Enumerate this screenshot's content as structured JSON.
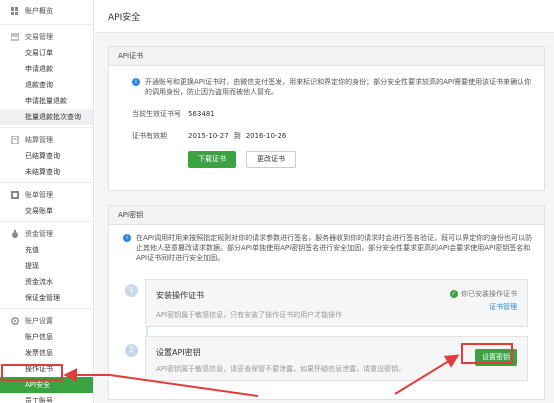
{
  "sidebar": {
    "account_overview": "账户概览",
    "trade_mgmt": {
      "title": "交易管理",
      "items": [
        "交易订单",
        "申请退款",
        "退款查询",
        "申请批量退款",
        "批量退款批次查询"
      ]
    },
    "settle_mgmt": {
      "title": "结算管理",
      "items": [
        "已结算查询",
        "未结算查询"
      ]
    },
    "bill_mgmt": {
      "title": "账单管理",
      "items": [
        "交易账单"
      ]
    },
    "fund_mgmt": {
      "title": "资金管理",
      "items": [
        "充值",
        "提现",
        "资金流水",
        "保证金管理"
      ]
    },
    "account_settings": {
      "title": "账户设置",
      "items": [
        "账户信息",
        "发票信息",
        "操作证书",
        "API安全",
        "员工账号"
      ]
    }
  },
  "main": {
    "title": "API安全",
    "cert_panel": {
      "title": "API证书",
      "note": "开通账号和更换API证书时，由微信支付签发，用来标识和界定你的身份；部分安全性要求较高的API需要使用该证书来确认你的调用身份，防止因为盗用而被他人冒充。",
      "cert_no_label": "当前生效证书号",
      "cert_no": "563481",
      "valid_label": "证书有效期",
      "valid_from": "2015-10-27",
      "valid_to_sep": "到",
      "valid_to": "2016-10-26",
      "download_btn": "下载证书",
      "change_btn": "更改证书"
    },
    "key_panel": {
      "title": "API密钥",
      "note": "在API调用时用来按照指定规则对你的请求参数进行签名，服务器收到你的请求时会进行签名验证，既可以界定你的身份也可以防止其他人恶意篡改请求数据。部分API单独使用API密钥签名进行安全加固，部分安全性要求更高的API会要求使用API密钥签名和API证书同时进行安全加固。",
      "step1": {
        "num": "1",
        "title": "安装操作证书",
        "desc": "API密钥属于敏感信息，只有安装了操作证书的用户才能操作",
        "status": "你已安装操作证书",
        "link": "证书管理"
      },
      "step2": {
        "num": "2",
        "title": "设置API密钥",
        "desc": "API密钥属于敏感信息，请妥善保管不要泄露，如果怀疑信息泄露，请重设密钥。",
        "btn": "设置密钥"
      }
    }
  },
  "colors": {
    "accent": "#3aa240",
    "annotation": "#e43c3c",
    "info": "#2d88d8"
  }
}
